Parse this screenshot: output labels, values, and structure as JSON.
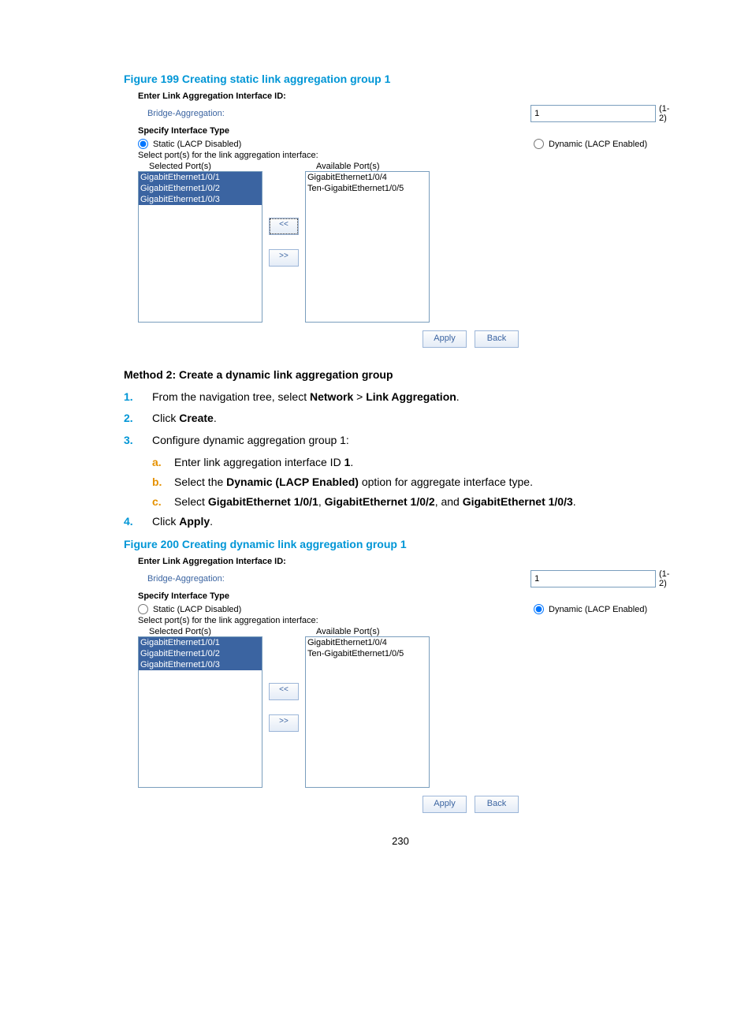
{
  "fig199": {
    "caption": "Figure 199 Creating static link aggregation group 1",
    "enter_id_label": "Enter Link Aggregation Interface ID:",
    "bridge_label": "Bridge-Aggregation:",
    "id_value": "1",
    "range": "(1-2)",
    "specify_type_label": "Specify Interface Type",
    "static_label": "Static (LACP Disabled)",
    "dynamic_label": "Dynamic (LACP Enabled)",
    "static_checked": true,
    "select_ports_label": "Select port(s) for the link aggregation interface:",
    "selected_hdr": "Selected Port(s)",
    "available_hdr": "Available Port(s)",
    "selected_ports": [
      "GigabitEthernet1/0/1",
      "GigabitEthernet1/0/2",
      "GigabitEthernet1/0/3"
    ],
    "available_ports": [
      "GigabitEthernet1/0/4",
      "Ten-GigabitEthernet1/0/5"
    ],
    "move_left": "<<",
    "move_right": ">>",
    "apply": "Apply",
    "back": "Back"
  },
  "method2": {
    "heading": "Method 2: Create a dynamic link aggregation group",
    "step1_pre": "From the navigation tree, select ",
    "step1_b1": "Network",
    "step1_mid": " > ",
    "step1_b2": "Link Aggregation",
    "step1_post": ".",
    "step2_pre": "Click ",
    "step2_b": "Create",
    "step2_post": ".",
    "step3": "Configure dynamic aggregation group 1:",
    "step3a_pre": "Enter link aggregation interface ID ",
    "step3a_b": "1",
    "step3a_post": ".",
    "step3b_pre": "Select the ",
    "step3b_b": "Dynamic (LACP Enabled)",
    "step3b_post": " option for aggregate interface type.",
    "step3c_pre": "Select ",
    "step3c_b1": "GigabitEthernet 1/0/1",
    "step3c_mid1": ", ",
    "step3c_b2": "GigabitEthernet 1/0/2",
    "step3c_mid2": ", and ",
    "step3c_b3": "GigabitEthernet 1/0/3",
    "step3c_post": ".",
    "step4_pre": "Click ",
    "step4_b": "Apply",
    "step4_post": "."
  },
  "fig200": {
    "caption": "Figure 200 Creating dynamic link aggregation group 1",
    "enter_id_label": "Enter Link Aggregation Interface ID:",
    "bridge_label": "Bridge-Aggregation:",
    "id_value": "1",
    "range": "(1-2)",
    "specify_type_label": "Specify Interface Type",
    "static_label": "Static (LACP Disabled)",
    "dynamic_label": "Dynamic (LACP Enabled)",
    "static_checked": false,
    "select_ports_label": "Select port(s) for the link aggregation interface:",
    "selected_hdr": "Selected Port(s)",
    "available_hdr": "Available Port(s)",
    "selected_ports": [
      "GigabitEthernet1/0/1",
      "GigabitEthernet1/0/2",
      "GigabitEthernet1/0/3"
    ],
    "available_ports": [
      "GigabitEthernet1/0/4",
      "Ten-GigabitEthernet1/0/5"
    ],
    "move_left": "<<",
    "move_right": ">>",
    "apply": "Apply",
    "back": "Back"
  },
  "page_number": "230"
}
